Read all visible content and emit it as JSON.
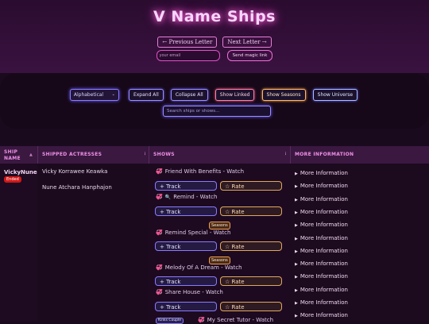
{
  "header": {
    "title": "V Name Ships",
    "prev_letter": "← Previous Letter",
    "next_letter": "Next Letter →",
    "email_placeholder": "your email",
    "magic_link": "Send magic link"
  },
  "controls": {
    "sort_selected": "Alphabetical",
    "expand_all": "Expand All",
    "collapse_all": "Collapse All",
    "show_linked": "Show Linked",
    "show_seasons": "Show Seasons",
    "show_universe": "Show Universe",
    "search_placeholder": "Search ships or shows..."
  },
  "table": {
    "headers": {
      "ship_name": "SHIP NAME",
      "actresses": "SHIPPED ACTRESSES",
      "shows": "SHOWS",
      "more_info": "MORE INFORMATION"
    },
    "ship_name": "VickyNune",
    "status": "Ended",
    "actresses": [
      "Vicky Korrawee Keawka",
      "Nune Atchara Hanphajon"
    ],
    "shows": [
      {
        "title": "Friend With Benefits - Watch",
        "icon": "heart-icon"
      },
      {
        "title": "Remind - Watch",
        "icon": "heart-icon",
        "extra_icon": "search-icon"
      },
      {
        "title": "Remind Special - Watch",
        "icon": "heart-icon",
        "badge": "Seasons"
      },
      {
        "title": "Melody Of A Dream - Watch",
        "icon": "heart-icon",
        "badge": "Seasons"
      },
      {
        "title": "Share House - Watch",
        "icon": "heart-icon"
      },
      {
        "title": "My Secret Tutor - Watch",
        "icon": "heart-icon",
        "badge": "Kinks Couple"
      }
    ],
    "track_label": "+ Track",
    "rate_label": "☆ Rate",
    "more_info_label": "More Information",
    "more_info_count": 12,
    "sort_arrow": "▲",
    "menu_dots": "⋮"
  }
}
